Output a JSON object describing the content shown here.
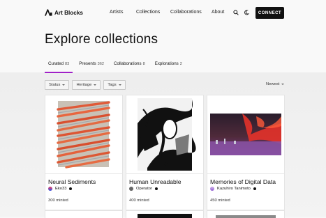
{
  "brand": {
    "name": "Art Blocks"
  },
  "nav": [
    "Artists",
    "Collections",
    "Collaborations",
    "About"
  ],
  "icons": {
    "search": "search-icon",
    "theme": "moon-icon",
    "logo": "art-blocks-logo-icon"
  },
  "connect_label": "CONNECT",
  "page_title": "Explore collections",
  "tabs": [
    {
      "label": "Curated",
      "count": "83",
      "active": true
    },
    {
      "label": "Presents",
      "count": "362"
    },
    {
      "label": "Collaborations",
      "count": "8"
    },
    {
      "label": "Explorations",
      "count": "2"
    }
  ],
  "filters": [
    "Status",
    "Heritage",
    "Tags"
  ],
  "sort_label": "Newest",
  "accent_color": "#a021c8",
  "collections": [
    {
      "name": "Neural Sediments",
      "artist": "Eko33",
      "minted": "300 minted"
    },
    {
      "name": "Human Unreadable",
      "artist": "Operator",
      "minted": "400 minted"
    },
    {
      "name": "Memories of Digital Data",
      "artist": "Kazuhiro Tanimoto",
      "minted": "450 minted"
    }
  ]
}
